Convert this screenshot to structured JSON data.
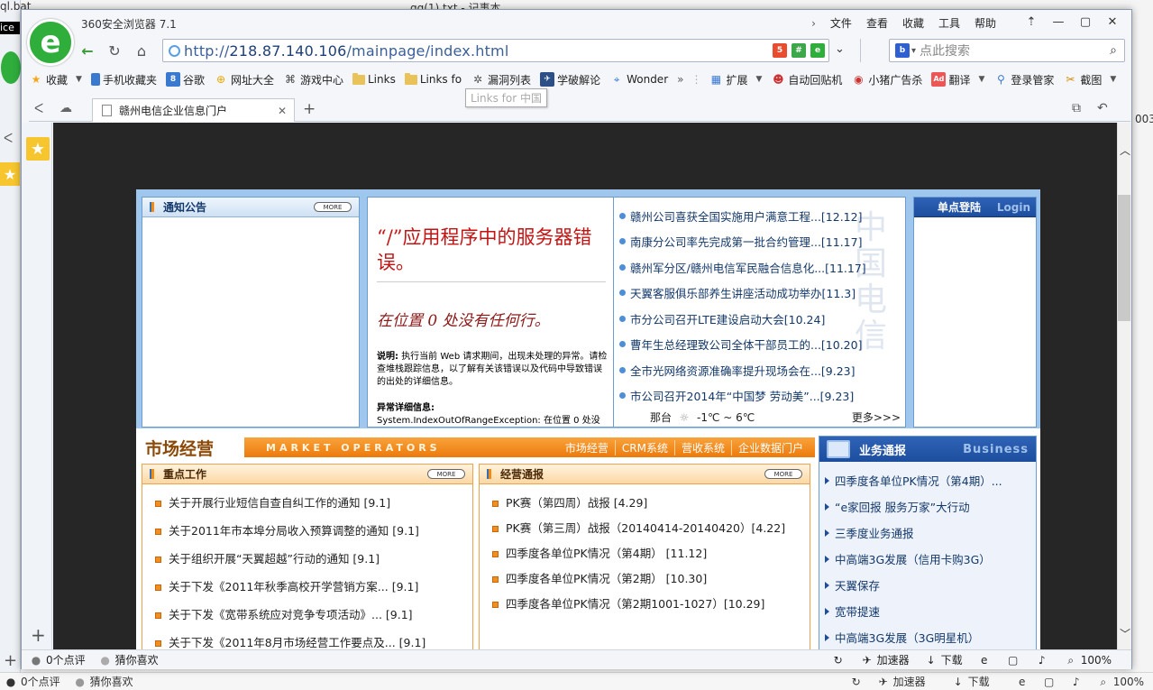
{
  "desktop": {
    "left_text_1": "ql.bat",
    "left_text_2": "ice",
    "window_behind_title": "qq(1).txt - 记事本",
    "right_fragment": "003",
    "taskbar": {
      "comments": "0个点评",
      "guess": "猜你喜欢",
      "accelerator": "加速器",
      "download": "下载",
      "zoom": "100%"
    }
  },
  "browser": {
    "title": "360安全浏览器 7.1",
    "menus": [
      "文件",
      "查看",
      "收藏",
      "工具",
      "帮助"
    ],
    "url_scheme": "http://",
    "url_host": "218.87.140.106",
    "url_path": "/mainpage/index.html",
    "search_placeholder": "点此搜索",
    "bookmarks": [
      "收藏",
      "手机收藏夹",
      "谷歌",
      "网址大全",
      "游戏中心",
      "Links",
      "Links fo",
      "漏洞列表",
      "学破解论",
      "Wonder",
      "扩展",
      "自动回贴机",
      "小猪广告杀",
      "翻译",
      "登录管家",
      "截图"
    ],
    "tooltip": "Links for 中国",
    "tab_title": "赣州电信企业信息门户",
    "status": {
      "comments": "0个点评",
      "guess": "猜你喜欢",
      "accelerator": "加速器",
      "download": "下载",
      "zoom": "100%"
    }
  },
  "page": {
    "notice": {
      "title": "通知公告",
      "more": "MORE"
    },
    "error": {
      "title": "“/”应用程序中的服务器错误。",
      "subtitle": "在位置 0 处没有任何行。",
      "desc_label": "说明:",
      "desc": "执行当前 Web 请求期间，出现未处理的异常。请检查堆栈跟踪信息，以了解有关该错误以及代码中导致错误的出处的详细信息。",
      "detail_label": "异常详细信息:",
      "detail": "System.IndexOutOfRangeException: 在位置 0 处没"
    },
    "news": {
      "items": [
        "赣州公司喜获全国实施用户满意工程...[12.12]",
        "南康分公司率先完成第一批合约管理...[11.17]",
        "赣州军分区/赣州电信军民融合信息化...[11.17]",
        "天翼客服俱乐部养生讲座活动成功举办[11.3]",
        "市分公司召开LTE建设启动大会[10.24]",
        "曹年生总经理致公司全体干部员工的...[10.20]",
        "全市光网络资源准确率提升现场会在...[9.23]",
        "市公司召开2014年“中国梦 劳动美”...[9.23]"
      ],
      "watermark": "中国电信",
      "weather_city": "那台",
      "weather_temp": "-1℃ ~ 6℃",
      "more": "更多>>>"
    },
    "login": {
      "title": "单点登陆",
      "title_en": "Login"
    },
    "market": {
      "logo": "市场经营",
      "title_en": "MARKET OPERATORS",
      "links": [
        "市场经营",
        "CRM系统",
        "营收系统",
        "企业数据门户"
      ]
    },
    "work": {
      "title": "重点工作",
      "more": "MORE",
      "items": [
        "关于开展行业短信自查自纠工作的通知 [9.1]",
        "关于2011年市本埠分局收入预算调整的通知 [9.1]",
        "关于组织开展“天翼超越”行动的通知 [9.1]",
        "关于下发《2011年秋季高校开学营销方案... [9.1]",
        "关于下发《宽带系统应对竞争专项活动》... [9.1]",
        "关于下发《2011年8月市场经营工作要点及... [9.1]"
      ]
    },
    "report": {
      "title": "经营通报",
      "more": "MORE",
      "items": [
        "PK赛（第四周）战报 [4.29]",
        "PK赛（第三周）战报（20140414-20140420）[4.22]",
        "四季度各单位PK情况（第4期） [11.12]",
        "四季度各单位PK情况（第2期） [10.30]",
        "四季度各单位PK情况（第2期1001-1027）[10.29]"
      ]
    },
    "business": {
      "title": "业务通报",
      "title_en": "Business",
      "items": [
        "四季度各单位PK情况（第4期）...",
        "“e家回报 服务万家”大行动",
        "三季度业务通报",
        "中高端3G发展（信用卡购3G）",
        "天翼保存",
        "宽带提速",
        "中高端3G发展（3G明星机）"
      ]
    }
  }
}
